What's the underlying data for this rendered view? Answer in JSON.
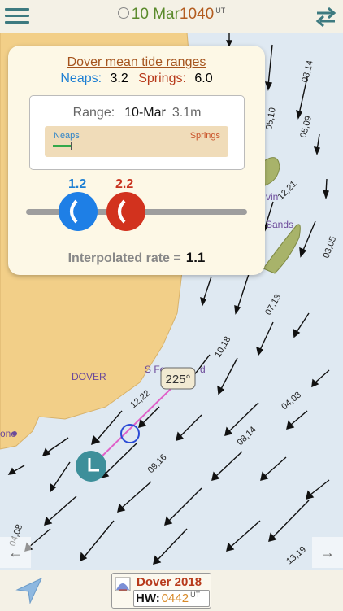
{
  "header": {
    "date": "10 Mar",
    "time": "1040",
    "time_zone": "UT"
  },
  "map": {
    "place_labels": [
      "DOVER",
      "S Fo",
      "d",
      "vin",
      "Sands",
      "one"
    ],
    "current_labels": [
      "08,14",
      "05,10",
      "05,09",
      "12,21",
      "03,05",
      "07,13",
      "10,18",
      "12,22",
      "04,08",
      "08,14",
      "09,16",
      "04,08",
      "13,19"
    ],
    "bearing": "225°"
  },
  "popup": {
    "title": "Dover mean tide ranges",
    "neaps_label": "Neaps:",
    "neaps_value": "3.2",
    "springs_label": "Springs:",
    "springs_value": "6.0",
    "range_label": "Range:",
    "range_date": "10-Mar",
    "range_value": "3.1m",
    "scale_neaps": "Neaps",
    "scale_springs": "Springs",
    "knob_neaps_value": "1.2",
    "knob_springs_value": "2.2",
    "interpolated_label": "Interpolated rate =",
    "interpolated_value": "1.1"
  },
  "footer": {
    "port": "Dover 2018",
    "hw_label": "HW:",
    "hw_time": "0442",
    "hw_zone": "UT"
  },
  "nav": {
    "prev": "←",
    "next": "→"
  },
  "colors": {
    "land": "#f2cf88",
    "sea": "#dfe9f2",
    "bank": "#a8b36a",
    "accent_teal": "#3d7a80",
    "neaps_blue": "#1d7fd3",
    "springs_red": "#c8321e"
  }
}
